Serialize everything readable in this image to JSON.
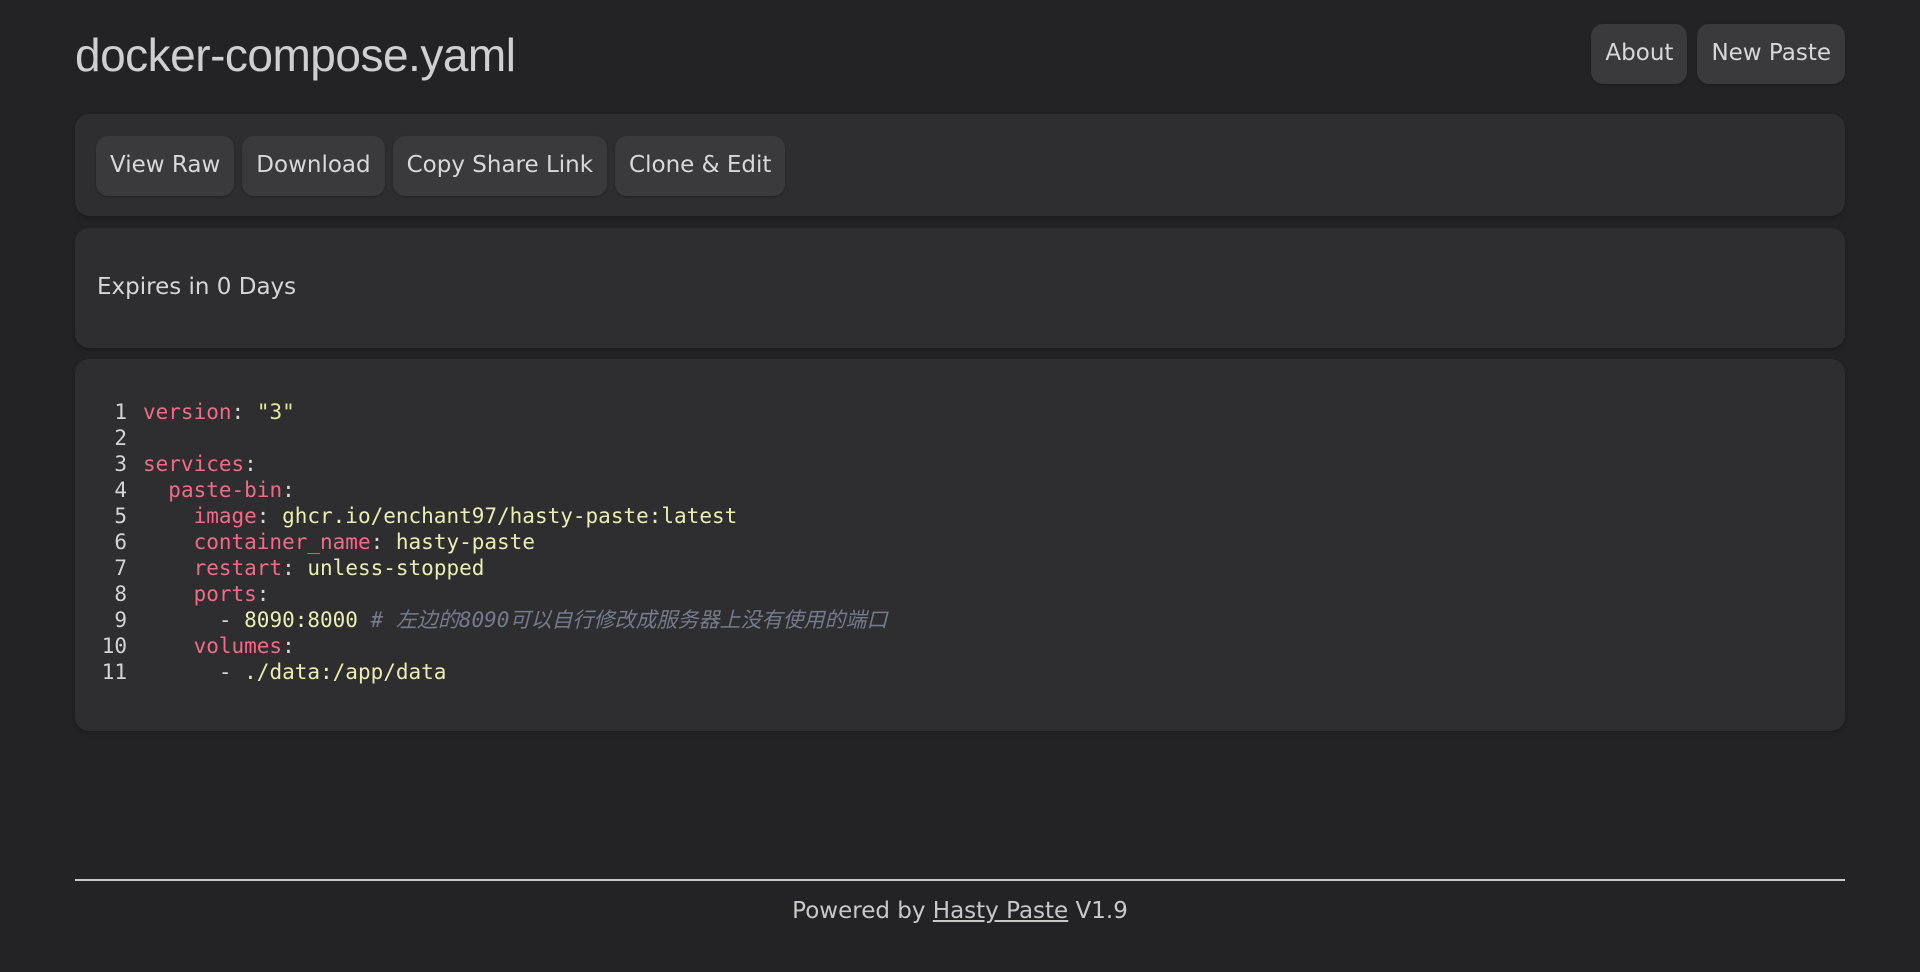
{
  "header": {
    "title": "docker-compose.yaml",
    "nav": {
      "about": "About",
      "new_paste": "New Paste"
    }
  },
  "toolbar": {
    "view_raw": "View Raw",
    "download": "Download",
    "copy_share_link": "Copy Share Link",
    "clone_edit": "Clone & Edit"
  },
  "expiry": {
    "text": "Expires in 0 Days"
  },
  "code": {
    "language": "yaml",
    "lines": [
      {
        "n": "1",
        "indent": "",
        "key": "version",
        "sep": ": ",
        "value": "\"3\"",
        "value_type": "str",
        "comment": ""
      },
      {
        "n": "2",
        "indent": "",
        "key": "",
        "sep": "",
        "value": "",
        "value_type": "",
        "comment": ""
      },
      {
        "n": "3",
        "indent": "",
        "key": "services",
        "sep": ":",
        "value": "",
        "value_type": "",
        "comment": ""
      },
      {
        "n": "4",
        "indent": "  ",
        "key": "paste-bin",
        "sep": ":",
        "value": "",
        "value_type": "",
        "comment": ""
      },
      {
        "n": "5",
        "indent": "    ",
        "key": "image",
        "sep": ": ",
        "value": "ghcr.io/enchant97/hasty-paste:latest",
        "value_type": "val",
        "comment": ""
      },
      {
        "n": "6",
        "indent": "    ",
        "key": "container_name",
        "sep": ": ",
        "value": "hasty-paste",
        "value_type": "val",
        "comment": ""
      },
      {
        "n": "7",
        "indent": "    ",
        "key": "restart",
        "sep": ": ",
        "value": "unless-stopped",
        "value_type": "val",
        "comment": ""
      },
      {
        "n": "8",
        "indent": "    ",
        "key": "ports",
        "sep": ":",
        "value": "",
        "value_type": "",
        "comment": ""
      },
      {
        "n": "9",
        "indent": "      ",
        "key": "",
        "sep": "- ",
        "value": "8090:8000",
        "value_type": "val",
        "comment": " # 左边的8090可以自行修改成服务器上没有使用的端口"
      },
      {
        "n": "10",
        "indent": "    ",
        "key": "volumes",
        "sep": ":",
        "value": "",
        "value_type": "",
        "comment": ""
      },
      {
        "n": "11",
        "indent": "      ",
        "key": "",
        "sep": "- ",
        "value": "./data:/app/data",
        "value_type": "val",
        "comment": ""
      }
    ]
  },
  "footer": {
    "prefix": "Powered by ",
    "link": "Hasty Paste",
    "suffix": " V1.9"
  },
  "colors": {
    "background": "#232325",
    "panel": "#2e2e30",
    "button": "#3a3a3c",
    "yaml_key": "#f06b86",
    "yaml_string": "#e6e89a",
    "yaml_comment": "#737b8c"
  }
}
